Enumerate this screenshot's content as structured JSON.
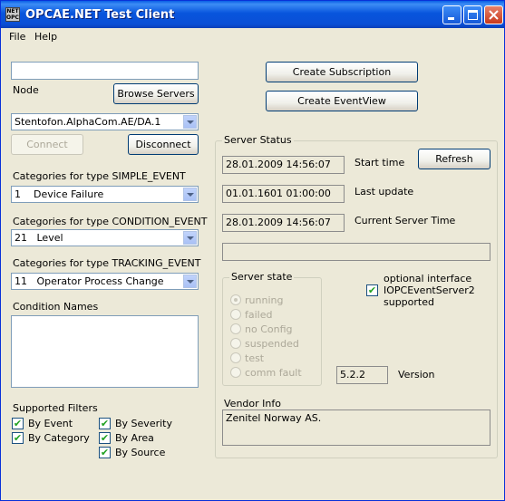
{
  "window": {
    "title": "OPCAE.NET Test Client",
    "icon_text": "NET OPC"
  },
  "menu": [
    "File",
    "Help"
  ],
  "left": {
    "node_value": "",
    "node_label": "Node",
    "browse_button": "Browse Servers",
    "server_selected": "Stentofon.AlphaCom.AE/DA.1",
    "connect_button": "Connect",
    "disconnect_button": "Disconnect",
    "simple_label": "Categories for type SIMPLE_EVENT",
    "simple_value": "1    Device Failure",
    "condition_label": "Categories for type CONDITION_EVENT",
    "condition_value": "21   Level",
    "tracking_label": "Categories for type TRACKING_EVENT",
    "tracking_value": "11   Operator Process Change",
    "condition_names_label": "Condition Names",
    "filters_label": "Supported Filters",
    "filters": [
      {
        "label": "By Event",
        "checked": true
      },
      {
        "label": "By Category",
        "checked": true
      },
      {
        "label": "By Severity",
        "checked": true
      },
      {
        "label": "By Area",
        "checked": true
      },
      {
        "label": "By Source",
        "checked": true
      }
    ]
  },
  "right": {
    "create_subscription": "Create Subscription",
    "create_eventview": "Create EventView",
    "status_title": "Server Status",
    "start_time": "28.01.2009 14:56:07",
    "start_time_label": "Start time",
    "refresh_button": "Refresh",
    "last_update": "01.01.1601 01:00:00",
    "last_update_label": "Last update",
    "current_time": "28.01.2009 14:56:07",
    "current_time_label": "Current Server Time",
    "status_text": "",
    "state_title": "Server state",
    "states": [
      "running",
      "failed",
      "no Config",
      "suspended",
      "test",
      "comm fault"
    ],
    "selected_state": "running",
    "optional_interface_label": "optional interface",
    "interface_name": "IOPCEventServer2",
    "supported_label": "supported",
    "interface_checked": true,
    "version_value": "5.2.2",
    "version_label": "Version",
    "vendor_label": "Vendor Info",
    "vendor_value": "Zenitel Norway AS."
  }
}
